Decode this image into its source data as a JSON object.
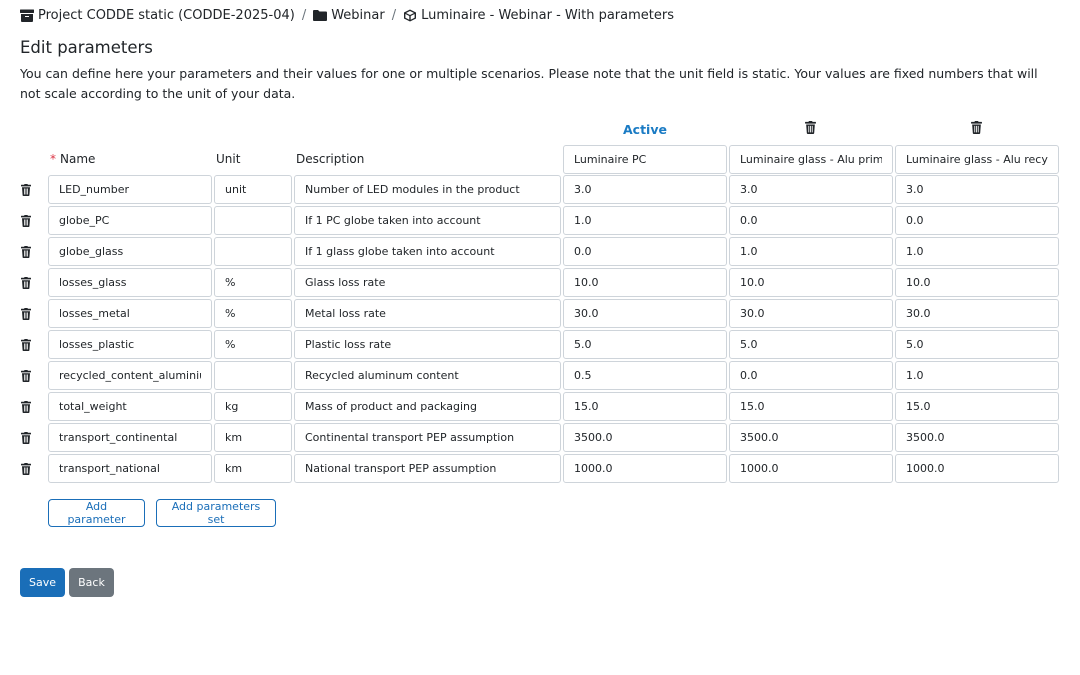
{
  "breadcrumb": [
    {
      "label": "Project CODDE static (CODDE-2025-04)",
      "icon": "archive-icon"
    },
    {
      "label": "Webinar",
      "icon": "folder-icon"
    },
    {
      "label": "Luminaire - Webinar - With parameters",
      "icon": "cube-icon"
    }
  ],
  "page": {
    "title": "Edit parameters",
    "intro": "You can define here your parameters and their values for one or multiple scenarios. Please note that the unit field is static. Your values are fixed numbers that will not scale according to the unit of your data."
  },
  "table": {
    "headers": {
      "required_mark": "*",
      "name": "Name",
      "unit": "Unit",
      "description": "Description"
    },
    "active_label": "Active",
    "sets": [
      "Luminaire PC",
      "Luminaire glass - Alu primary",
      "Luminaire glass - Alu recycled"
    ],
    "rows": [
      {
        "name": "LED_number",
        "unit": "unit",
        "description": "Number of LED modules in the product",
        "values": [
          "3.0",
          "3.0",
          "3.0"
        ]
      },
      {
        "name": "globe_PC",
        "unit": "",
        "description": "If 1 PC globe taken into account",
        "values": [
          "1.0",
          "0.0",
          "0.0"
        ]
      },
      {
        "name": "globe_glass",
        "unit": "",
        "description": "If 1 glass globe taken into account",
        "values": [
          "0.0",
          "1.0",
          "1.0"
        ]
      },
      {
        "name": "losses_glass",
        "unit": "%",
        "description": "Glass loss rate",
        "values": [
          "10.0",
          "10.0",
          "10.0"
        ]
      },
      {
        "name": "losses_metal",
        "unit": "%",
        "description": "Metal loss rate",
        "values": [
          "30.0",
          "30.0",
          "30.0"
        ]
      },
      {
        "name": "losses_plastic",
        "unit": "%",
        "description": "Plastic loss rate",
        "values": [
          "5.0",
          "5.0",
          "5.0"
        ]
      },
      {
        "name": "recycled_content_aluminium",
        "unit": "",
        "description": "Recycled aluminum content",
        "values": [
          "0.5",
          "0.0",
          "1.0"
        ]
      },
      {
        "name": "total_weight",
        "unit": "kg",
        "description": "Mass of product and packaging",
        "values": [
          "15.0",
          "15.0",
          "15.0"
        ]
      },
      {
        "name": "transport_continental",
        "unit": "km",
        "description": "Continental transport PEP assumption",
        "values": [
          "3500.0",
          "3500.0",
          "3500.0"
        ]
      },
      {
        "name": "transport_national",
        "unit": "km",
        "description": "National transport PEP assumption",
        "values": [
          "1000.0",
          "1000.0",
          "1000.0"
        ]
      }
    ]
  },
  "actions": {
    "add_parameter": "Add parameter",
    "add_parameters_set": "Add parameters set",
    "save": "Save",
    "back": "Back"
  },
  "colors": {
    "primary": "#1a6eb8",
    "active": "#1a7bc4",
    "secondary": "#6c757d",
    "required": "#dc3545"
  }
}
